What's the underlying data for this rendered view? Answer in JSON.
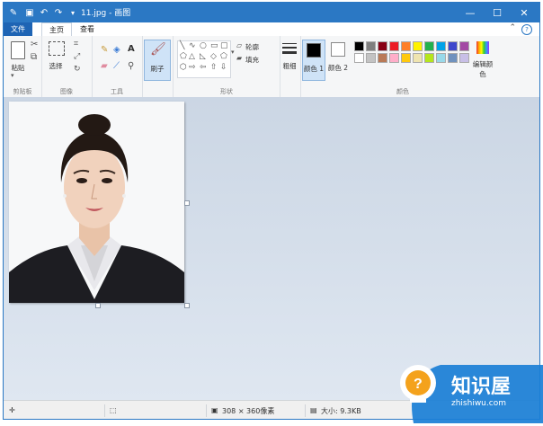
{
  "window": {
    "title": "11.jpg - 画图",
    "controls": {
      "minimize": "—",
      "maximize": "☐",
      "close": "✕"
    }
  },
  "quick_access": {
    "icons": [
      "app-icon",
      "save-icon",
      "undo-icon",
      "redo-icon",
      "customize-icon"
    ]
  },
  "tabs": [
    {
      "label": "文件",
      "active": false
    },
    {
      "label": "主页",
      "active": true
    },
    {
      "label": "查看",
      "active": false
    }
  ],
  "ribbon": {
    "clipboard": {
      "paste": "粘贴",
      "group": "剪贴板"
    },
    "image": {
      "select": "选择",
      "group": "图像"
    },
    "tools": {
      "group": "工具",
      "text": "A"
    },
    "brushes": {
      "label": "刷子"
    },
    "shapes": {
      "outline": "轮廓",
      "fill": "填充",
      "group": "形状"
    },
    "size": {
      "label": "粗细"
    },
    "colors": {
      "color1": "颜色 1",
      "color2": "颜色 2",
      "edit": "编辑颜色",
      "group": "颜色",
      "color1_value": "#000000",
      "color2_value": "#ffffff",
      "palette_row1": [
        "#000000",
        "#7f7f7f",
        "#880015",
        "#ed1c24",
        "#ff7f27",
        "#fff200",
        "#22b14c",
        "#00a2e8",
        "#3f48cc",
        "#a349a4"
      ],
      "palette_row2": [
        "#ffffff",
        "#c3c3c3",
        "#b97a57",
        "#ffaec9",
        "#ffc90e",
        "#efe4b0",
        "#b5e61d",
        "#99d9ea",
        "#7092be",
        "#c8bfe7"
      ]
    }
  },
  "status": {
    "dimensions": "308 × 360像素",
    "file_size": "大小: 9.3KB"
  },
  "watermark": {
    "name": "知识屋",
    "url": "zhishiwu.com"
  },
  "colors": {
    "titlebar": "#2b78c4",
    "file_tab": "#1e64b4",
    "canvas_bg": "#cdd8e6"
  }
}
